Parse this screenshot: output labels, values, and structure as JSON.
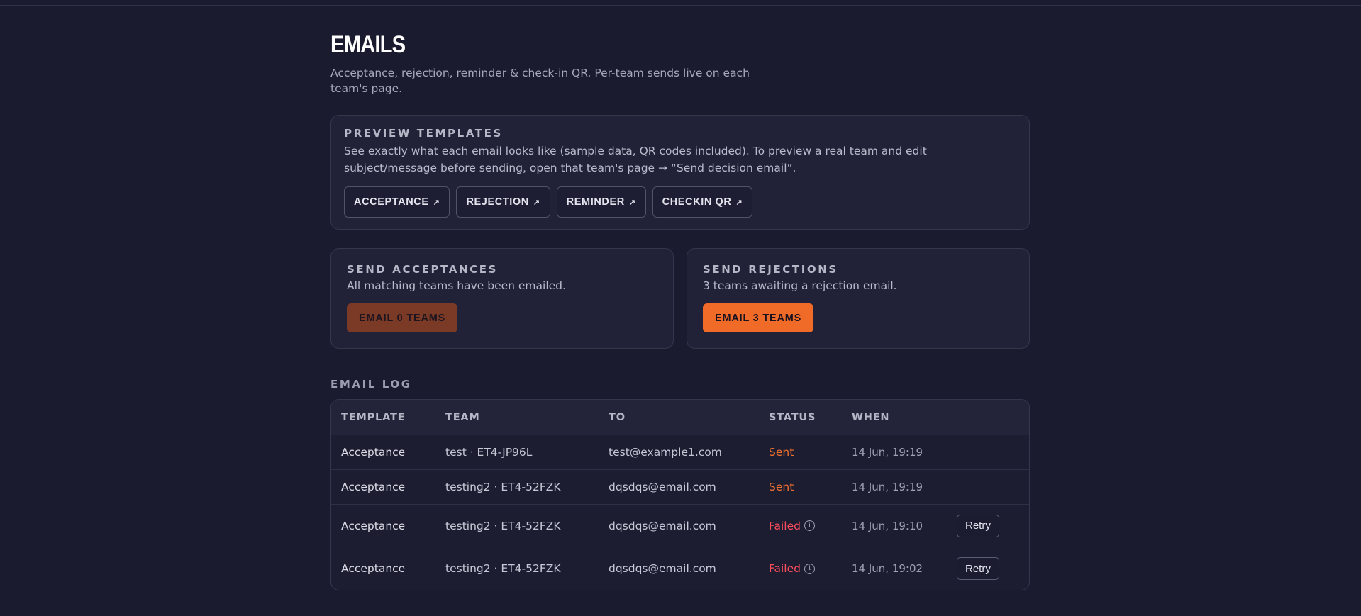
{
  "page": {
    "title": "EMAILS",
    "subtitle": "Acceptance, rejection, reminder & check-in QR. Per-team sends live on each team's page."
  },
  "preview": {
    "label": "PREVIEW TEMPLATES",
    "description": "See exactly what each email looks like (sample data, QR codes included). To preview a real team and edit subject/message before sending, open that team's page → “Send decision email”.",
    "arrow_glyph": "↗",
    "templates": [
      {
        "label": "ACCEPTANCE"
      },
      {
        "label": "REJECTION"
      },
      {
        "label": "REMINDER"
      },
      {
        "label": "CHECKIN QR"
      }
    ]
  },
  "send_acceptances": {
    "label": "SEND ACCEPTANCES",
    "text": "All matching teams have been emailed.",
    "button": "EMAIL 0 TEAMS",
    "enabled": false
  },
  "send_rejections": {
    "label": "SEND REJECTIONS",
    "text": "3 teams awaiting a rejection email.",
    "button": "EMAIL 3 TEAMS",
    "enabled": true
  },
  "log": {
    "label": "EMAIL LOG",
    "columns": [
      "TEMPLATE",
      "TEAM",
      "TO",
      "STATUS",
      "WHEN"
    ],
    "retry_label": "Retry",
    "info_glyph": "i",
    "rows": [
      {
        "template": "Acceptance",
        "team": "test · ET4-JP96L",
        "to": "test@example1.com",
        "status": "Sent",
        "when": "14 Jun, 19:19",
        "retry": false
      },
      {
        "template": "Acceptance",
        "team": "testing2 · ET4-52FZK",
        "to": "dqsdqs@email.com",
        "status": "Sent",
        "when": "14 Jun, 19:19",
        "retry": false
      },
      {
        "template": "Acceptance",
        "team": "testing2 · ET4-52FZK",
        "to": "dqsdqs@email.com",
        "status": "Failed",
        "when": "14 Jun, 19:10",
        "retry": true
      },
      {
        "template": "Acceptance",
        "team": "testing2 · ET4-52FZK",
        "to": "dqsdqs@email.com",
        "status": "Failed",
        "when": "14 Jun, 19:02",
        "retry": true
      }
    ]
  },
  "colors": {
    "background": "#1b1b2f",
    "accent": "#f16b28",
    "status_sent": "#f0702f",
    "status_failed": "#ff4d5e"
  }
}
